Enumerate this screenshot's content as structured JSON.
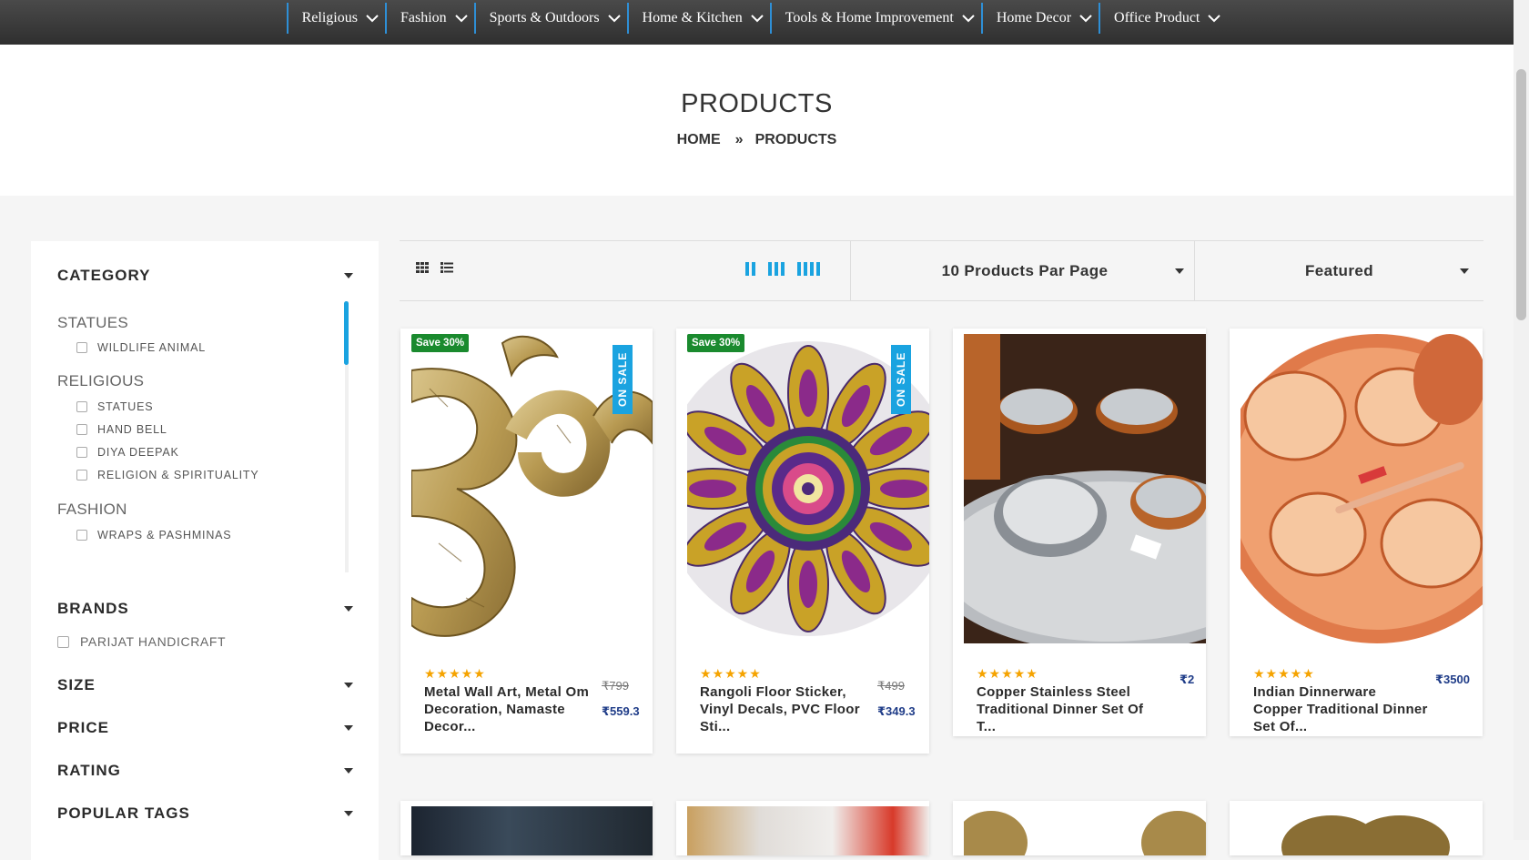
{
  "nav": {
    "items": [
      {
        "label": "Religious"
      },
      {
        "label": "Fashion"
      },
      {
        "label": "Sports & Outdoors"
      },
      {
        "label": "Home & Kitchen"
      },
      {
        "label": "Tools & Home Improvement"
      },
      {
        "label": "Home Decor"
      },
      {
        "label": "Office Product"
      }
    ]
  },
  "banner": {
    "title": "PRODUCTS",
    "breadcrumb": {
      "home": "HOME",
      "separator": "»",
      "current": "PRODUCTS"
    }
  },
  "sidebar": {
    "category": {
      "title": "CATEGORY",
      "groups": [
        {
          "title": "STATUES",
          "items": [
            "WILDLIFE ANIMAL"
          ]
        },
        {
          "title": "RELIGIOUS",
          "items": [
            "STATUES",
            "HAND BELL",
            "DIYA DEEPAK",
            "RELIGION & SPIRITUALITY"
          ]
        },
        {
          "title": "FASHION",
          "items": [
            "WRAPS & PASHMINAS"
          ]
        }
      ]
    },
    "brands": {
      "title": "BRANDS",
      "items": [
        "PARIJAT HANDICRAFT"
      ]
    },
    "size": {
      "title": "SIZE"
    },
    "price": {
      "title": "PRICE"
    },
    "rating": {
      "title": "RATING"
    },
    "popular_tags": {
      "title": "POPULAR TAGS"
    }
  },
  "toolbar": {
    "per_page": "10 Products Par Page",
    "sort": "Featured"
  },
  "products": [
    {
      "save": "Save 30%",
      "on_sale": "ON SALE",
      "stars": "★★★★★",
      "name": "Metal Wall Art, Metal Om Decoration, Namaste Decor...",
      "old_price": "₹799",
      "price": "₹559.3"
    },
    {
      "save": "Save 30%",
      "on_sale": "ON SALE",
      "stars": "★★★★★",
      "name": "Rangoli Floor Sticker, Vinyl Decals, PVC Floor Sti...",
      "old_price": "₹499",
      "price": "₹349.3"
    },
    {
      "stars": "★★★★★",
      "name": "Copper Stainless Steel Traditional Dinner Set Of T...",
      "price": "₹2"
    },
    {
      "stars": "★★★★★",
      "name": "Indian Dinnerware Copper Traditional Dinner Set Of...",
      "price": "₹3500"
    }
  ],
  "colors": {
    "accent": "#1aa3e0",
    "save_badge": "#1a8a2e",
    "price": "#1f3c88",
    "star": "#f5a300",
    "nav_bg": "#3c3c3c"
  }
}
